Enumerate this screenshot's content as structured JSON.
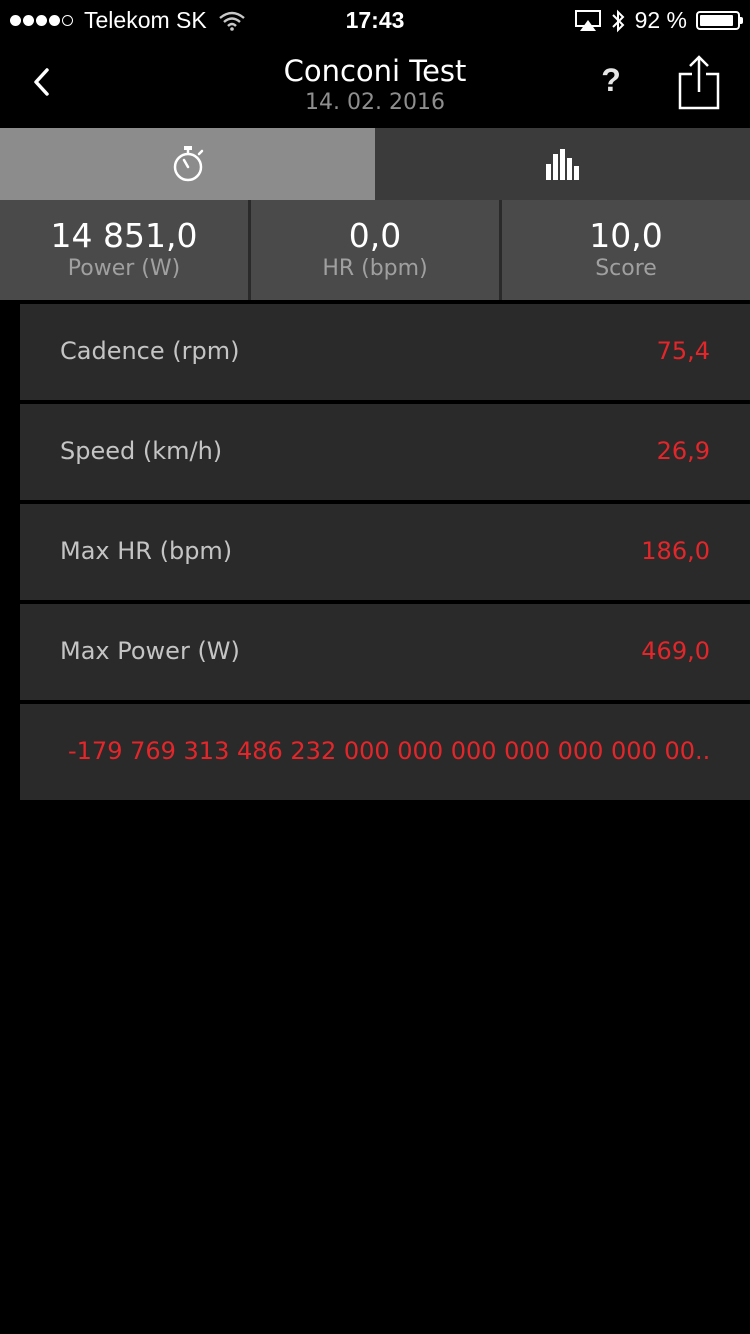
{
  "status_bar": {
    "carrier": "Telekom SK",
    "time": "17:43",
    "battery_percent": "92 %",
    "battery_level": 0.92,
    "signal_bars_filled": 4,
    "signal_bars_total": 5
  },
  "nav": {
    "title": "Conconi Test",
    "subtitle": "14. 02. 2016",
    "help_label": "?"
  },
  "tabs": [
    {
      "icon": "stopwatch-icon",
      "active": true
    },
    {
      "icon": "bar-chart-icon",
      "active": false
    }
  ],
  "summary": [
    {
      "value": "14 851,0",
      "label": "Power (W)"
    },
    {
      "value": "0,0",
      "label": "HR (bpm)"
    },
    {
      "value": "10,0",
      "label": "Score"
    }
  ],
  "rows": [
    {
      "label": "Cadence (rpm)",
      "value": "75,4"
    },
    {
      "label": "Speed (km/h)",
      "value": "26,9"
    },
    {
      "label": "Max HR (bpm)",
      "value": "186,0"
    },
    {
      "label": "Max Power (W)",
      "value": "469,0"
    }
  ],
  "long_value": "-179 769 313 486 232 000 000 000 000 000 000 00...",
  "colors": {
    "accent_red": "#e3262a",
    "tab_active": "#8c8c8c",
    "tab_inactive": "#3b3b3b",
    "summary_bg": "#4a4a4a",
    "row_bg": "#2a2a2a"
  }
}
